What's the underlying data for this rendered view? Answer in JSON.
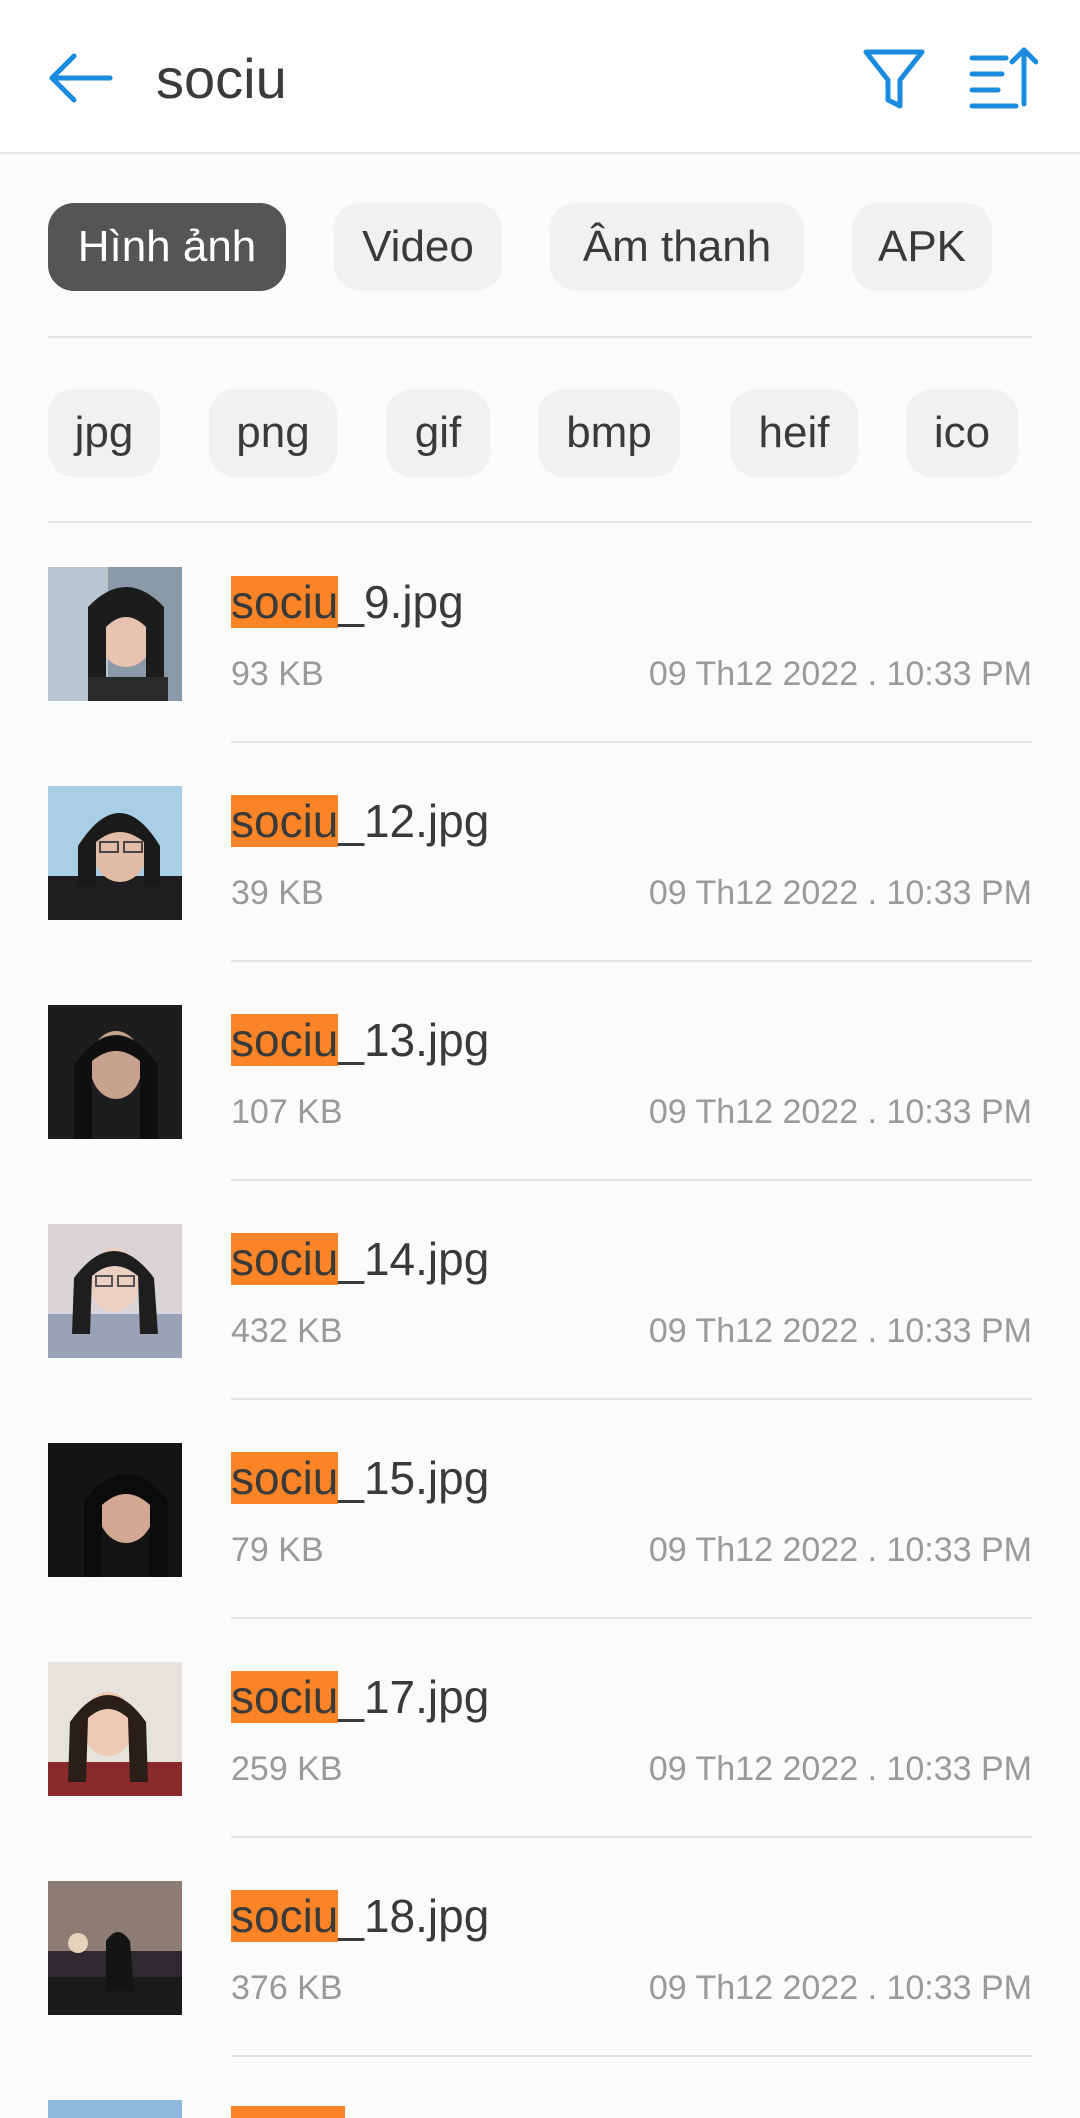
{
  "header": {
    "title": "sociu",
    "back_icon": "arrow-left-icon",
    "filter_icon": "filter-icon",
    "sort_icon": "sort-icon",
    "accent": "#1a8ce0"
  },
  "categories": [
    {
      "label": "Hình ảnh",
      "active": true
    },
    {
      "label": "Video",
      "active": false
    },
    {
      "label": "Âm thanh",
      "active": false
    },
    {
      "label": "APK",
      "active": false
    }
  ],
  "formats": [
    "jpg",
    "png",
    "gif",
    "bmp",
    "heif",
    "ico"
  ],
  "highlight_color": "#fb8526",
  "files": [
    {
      "match": "sociu",
      "rest": "_9.jpg",
      "size": "93 KB",
      "date": "09 Th12 2022 . 10:33 PM"
    },
    {
      "match": "sociu",
      "rest": "_12.jpg",
      "size": "39 KB",
      "date": "09 Th12 2022 . 10:33 PM"
    },
    {
      "match": "sociu",
      "rest": "_13.jpg",
      "size": "107 KB",
      "date": "09 Th12 2022 . 10:33 PM"
    },
    {
      "match": "sociu",
      "rest": "_14.jpg",
      "size": "432 KB",
      "date": "09 Th12 2022 . 10:33 PM"
    },
    {
      "match": "sociu",
      "rest": "_15.jpg",
      "size": "79 KB",
      "date": "09 Th12 2022 . 10:33 PM"
    },
    {
      "match": "sociu",
      "rest": "_17.jpg",
      "size": "259 KB",
      "date": "09 Th12 2022 . 10:33 PM"
    },
    {
      "match": "sociu",
      "rest": "_18.jpg",
      "size": "376 KB",
      "date": "09 Th12 2022 . 10:33 PM"
    }
  ]
}
